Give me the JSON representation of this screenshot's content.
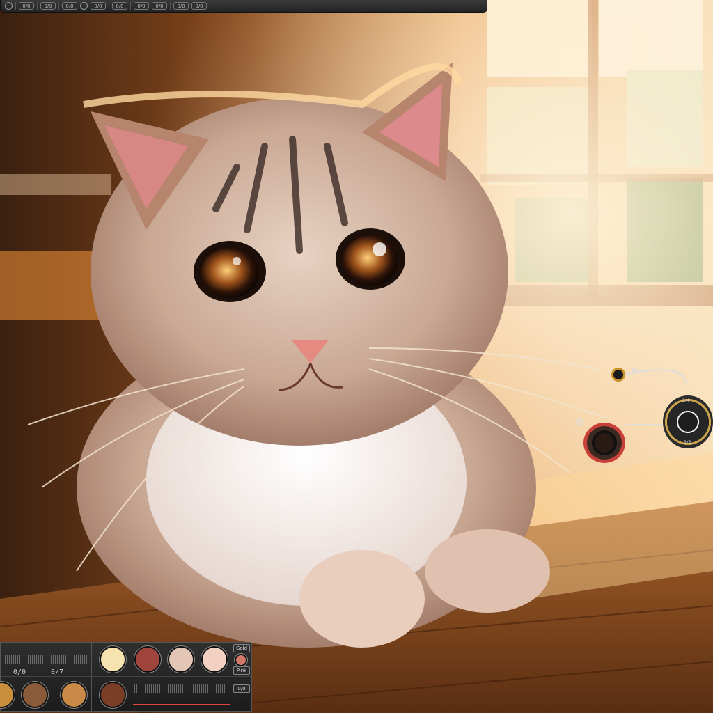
{
  "top_toolbar": {
    "buttons": [
      "0/0",
      "0/0",
      "0/0",
      "0/0",
      "0/0",
      "0/0",
      "0/0",
      "0/0",
      "0/0"
    ]
  },
  "palette": {
    "left_label_a": "0/0",
    "left_label_b": "0/7",
    "side_label_top": "Gold",
    "side_label_mid": "Pink",
    "side_label_bot": "0/0",
    "swatch_colors_top": [
      "#f7e3b0",
      "#a0443e",
      "#e3c6b6",
      "#f3d1c2"
    ],
    "swatch_colors_bottom": [
      "#c8903c",
      "#8b5a38",
      "#c98a48",
      "#7a3e26"
    ],
    "swatch_small": "#d0786a",
    "accent": "#c7403a"
  },
  "dial": {
    "top": "0/0",
    "bottom": "0/0"
  }
}
